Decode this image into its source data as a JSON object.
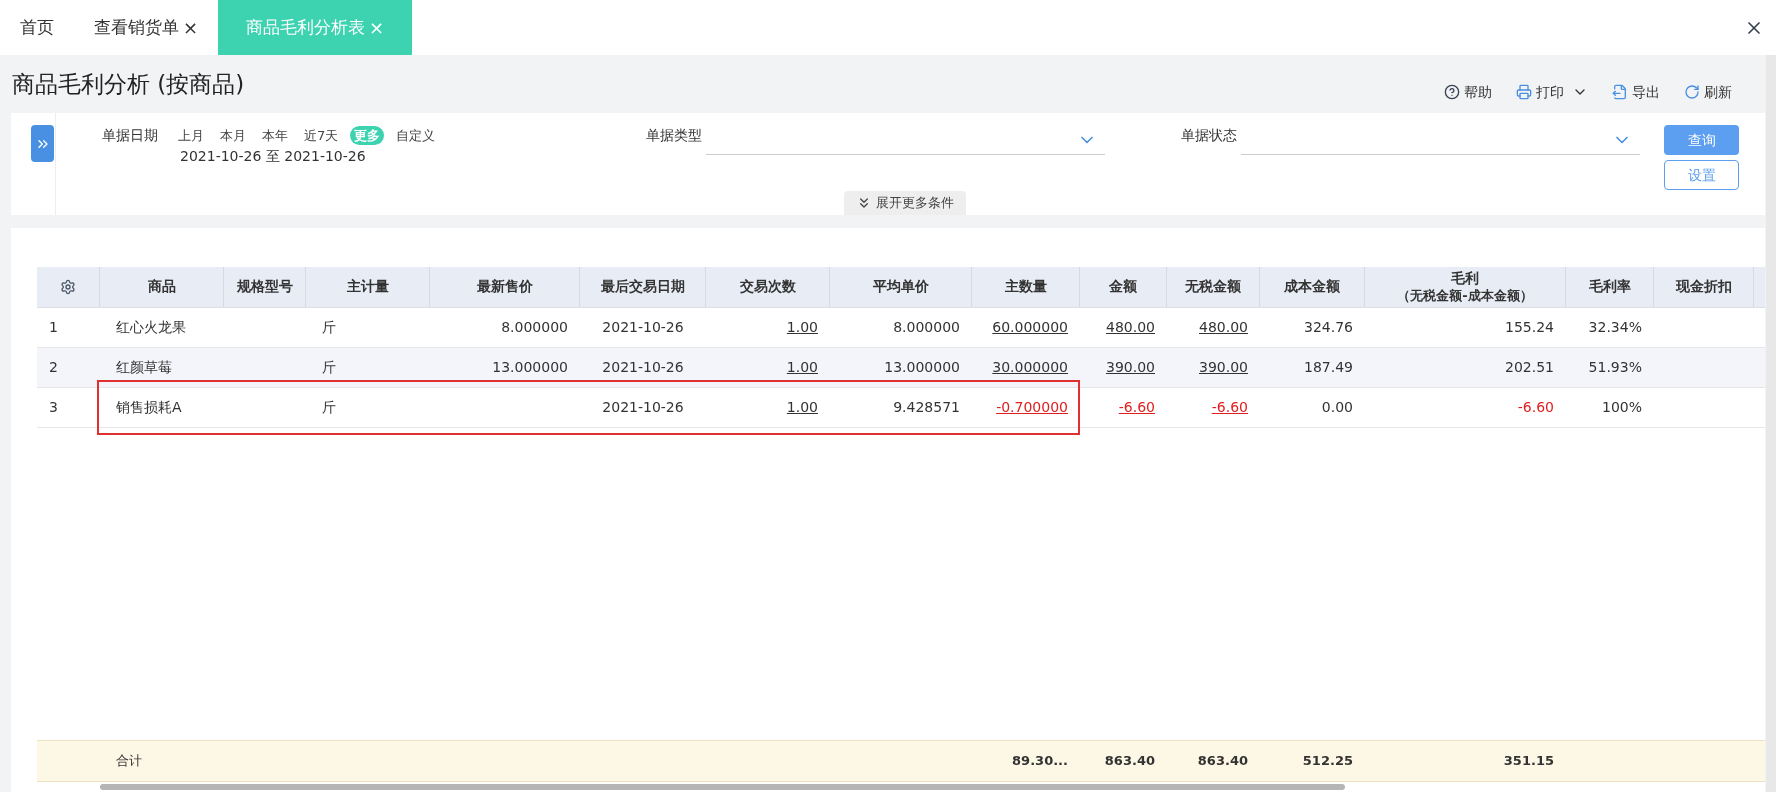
{
  "tabs": [
    {
      "label": "首页",
      "closable": false,
      "selected": false
    },
    {
      "label": "查看销货单",
      "closable": true,
      "selected": false
    },
    {
      "label": "商品毛利分析表",
      "closable": true,
      "selected": true
    }
  ],
  "close_glyph": "×",
  "page_title": "商品毛利分析 (按商品)",
  "toolbar": [
    {
      "kind": "help",
      "label": "帮助"
    },
    {
      "kind": "print",
      "label": "打印"
    },
    {
      "kind": "export",
      "label": "导出"
    },
    {
      "kind": "refresh",
      "label": "刷新"
    }
  ],
  "filters": {
    "date": {
      "label": "单据日期",
      "presets": [
        {
          "label": "上月",
          "selected": false
        },
        {
          "label": "本月",
          "selected": false
        },
        {
          "label": "本年",
          "selected": false
        },
        {
          "label": "近7天",
          "selected": false
        },
        {
          "label": "更多",
          "selected": true
        },
        {
          "label": "自定义",
          "selected": false
        }
      ],
      "range": "2021-10-26 至 2021-10-26"
    },
    "selects": [
      {
        "label": "单据类型"
      },
      {
        "label": "单据状态"
      }
    ],
    "query_button": "查询",
    "settings_button": "设置",
    "more_conditions": "展开更多条件"
  },
  "table": {
    "columns": [
      {
        "kind": "settings"
      },
      {
        "label": "商品"
      },
      {
        "label": "规格型号"
      },
      {
        "label": "主计量"
      },
      {
        "label": "最新售价"
      },
      {
        "label": "最后交易日期"
      },
      {
        "label": "交易次数"
      },
      {
        "label": "平均单价"
      },
      {
        "label": "主数量"
      },
      {
        "label": "金额"
      },
      {
        "label": "无税金额"
      },
      {
        "label": "成本金额"
      },
      {
        "label": "毛利",
        "subheading": "（无税金额-成本金额）"
      },
      {
        "label": "毛利率"
      },
      {
        "label": "现金折扣"
      }
    ],
    "rows": [
      {
        "highlighted": false,
        "cells": [
          {
            "text": "1",
            "underline": false,
            "red": false
          },
          {
            "text": "红心火龙果",
            "underline": false,
            "red": false
          },
          null,
          {
            "text": "斤",
            "underline": false,
            "red": false
          },
          {
            "text": "8.000000",
            "underline": false,
            "red": false
          },
          {
            "text": "2021-10-26",
            "underline": false,
            "red": false
          },
          {
            "text": "1.00",
            "underline": true,
            "red": false
          },
          {
            "text": "8.000000",
            "underline": false,
            "red": false
          },
          {
            "text": "60.000000",
            "underline": true,
            "red": false
          },
          {
            "text": "480.00",
            "underline": true,
            "red": false
          },
          {
            "text": "480.00",
            "underline": true,
            "red": false
          },
          {
            "text": "324.76",
            "underline": false,
            "red": false
          },
          {
            "text": "155.24",
            "underline": false,
            "red": false
          },
          {
            "text": "32.34%",
            "underline": false,
            "red": false
          },
          null
        ]
      },
      {
        "highlighted": false,
        "cells": [
          {
            "text": "2",
            "underline": false,
            "red": false
          },
          {
            "text": "红颜草莓",
            "underline": false,
            "red": false
          },
          null,
          {
            "text": "斤",
            "underline": false,
            "red": false
          },
          {
            "text": "13.000000",
            "underline": false,
            "red": false
          },
          {
            "text": "2021-10-26",
            "underline": false,
            "red": false
          },
          {
            "text": "1.00",
            "underline": true,
            "red": false
          },
          {
            "text": "13.000000",
            "underline": false,
            "red": false
          },
          {
            "text": "30.000000",
            "underline": true,
            "red": false
          },
          {
            "text": "390.00",
            "underline": true,
            "red": false
          },
          {
            "text": "390.00",
            "underline": true,
            "red": false
          },
          {
            "text": "187.49",
            "underline": false,
            "red": false
          },
          {
            "text": "202.51",
            "underline": false,
            "red": false
          },
          {
            "text": "51.93%",
            "underline": false,
            "red": false
          },
          null
        ]
      },
      {
        "highlighted": true,
        "cells": [
          {
            "text": "3",
            "underline": false,
            "red": false
          },
          {
            "text": "销售损耗A",
            "underline": false,
            "red": false
          },
          null,
          {
            "text": "斤",
            "underline": false,
            "red": false
          },
          null,
          {
            "text": "2021-10-26",
            "underline": false,
            "red": false
          },
          {
            "text": "1.00",
            "underline": true,
            "red": false
          },
          {
            "text": "9.428571",
            "underline": false,
            "red": false
          },
          {
            "text": "-0.700000",
            "underline": true,
            "red": true
          },
          {
            "text": "-6.60",
            "underline": true,
            "red": true
          },
          {
            "text": "-6.60",
            "underline": true,
            "red": true
          },
          {
            "text": "0.00",
            "underline": false,
            "red": false
          },
          {
            "text": "-6.60",
            "underline": false,
            "red": true
          },
          {
            "text": "100%",
            "underline": false,
            "red": false
          },
          null
        ]
      }
    ],
    "totals": {
      "label": "合计",
      "values": [
        "89.30...",
        "863.40",
        "863.40",
        "512.25",
        "351.15"
      ]
    }
  }
}
